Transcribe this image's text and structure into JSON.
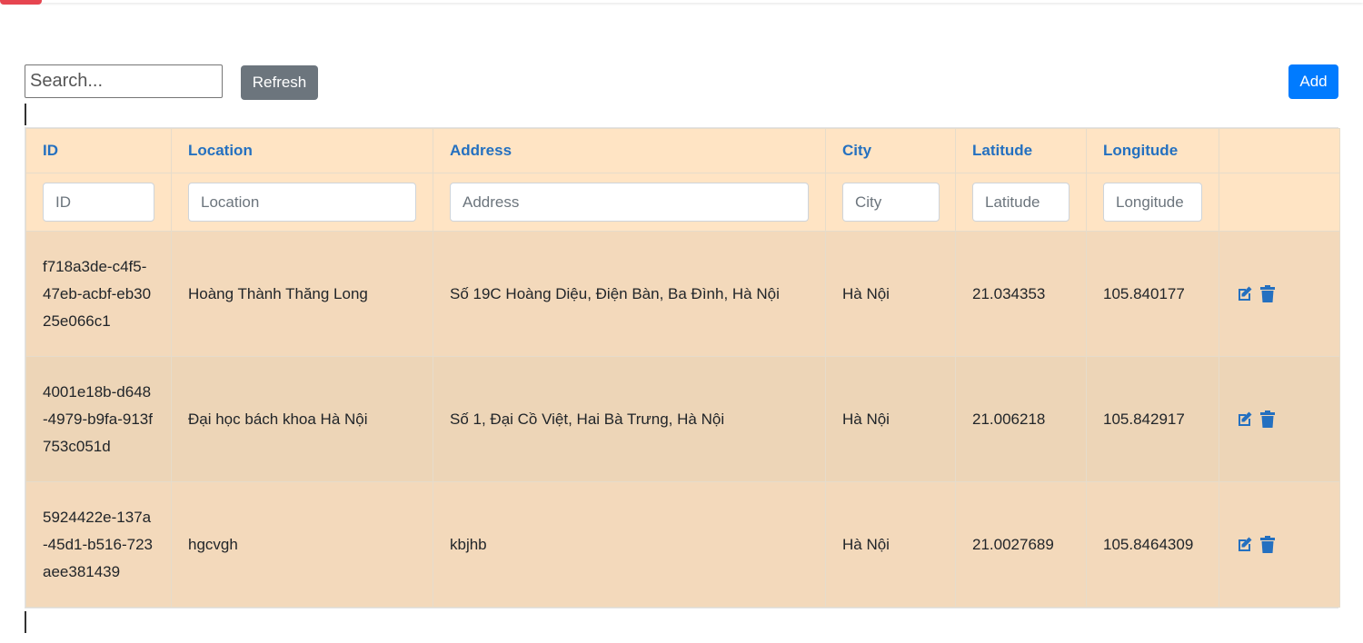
{
  "toolbar": {
    "search_placeholder": "Search...",
    "refresh_label": "Refresh",
    "add_label": "Add"
  },
  "table": {
    "columns": [
      "ID",
      "Location",
      "Address",
      "City",
      "Latitude",
      "Longitude",
      ""
    ],
    "filters": [
      "ID",
      "Location",
      "Address",
      "City",
      "Latitude",
      "Longitude"
    ],
    "rows": [
      {
        "id": "f718a3de-c4f5-47eb-acbf-eb3025e066c1",
        "location": "Hoàng Thành Thăng Long",
        "address": "Số 19C Hoàng Diệu, Điện Bàn, Ba Đình, Hà Nội",
        "city": "Hà Nội",
        "latitude": "21.034353",
        "longitude": "105.840177"
      },
      {
        "id": "4001e18b-d648-4979-b9fa-913f753c051d",
        "location": "Đại học bách khoa Hà Nội",
        "address": "Số 1, Đại Cồ Việt, Hai Bà Trưng, Hà Nội",
        "city": "Hà Nội",
        "latitude": "21.006218",
        "longitude": "105.842917"
      },
      {
        "id": "5924422e-137a-45d1-b516-723aee381439",
        "location": "hgcvgh",
        "address": "kbjhb",
        "city": "Hà Nội",
        "latitude": "21.0027689",
        "longitude": "105.8464309"
      }
    ]
  },
  "icons": {
    "edit": "edit-icon",
    "delete": "trash-icon"
  },
  "colors": {
    "header_bg": "#ffe4c4",
    "row_bg": "#f3d9bb",
    "row_alt_bg": "#edd5b7",
    "header_text": "#2470c0",
    "refresh_bg": "#6c757d",
    "add_bg": "#007bff",
    "icon_color": "#2470c0"
  }
}
